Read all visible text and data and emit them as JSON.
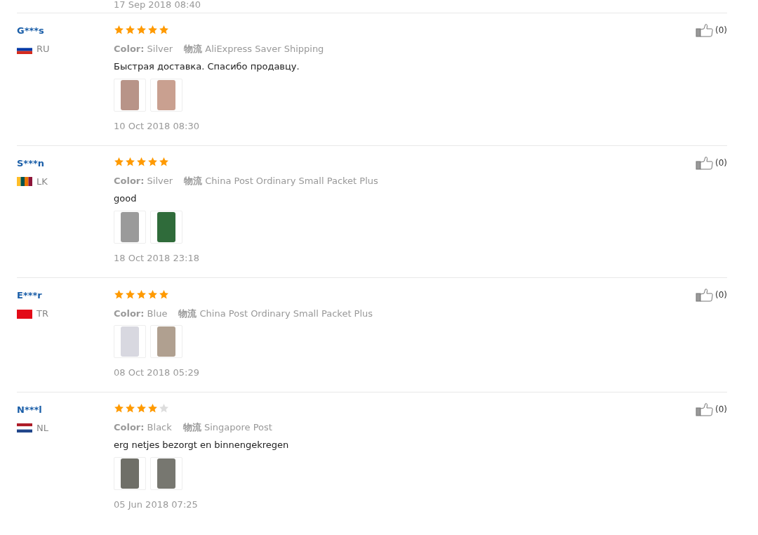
{
  "previous_review": {
    "date": "17 Sep 2018 08:40"
  },
  "reviews": [
    {
      "user": "G***s",
      "country": "RU",
      "flag": {
        "kind": "russia"
      },
      "stars": 5,
      "color_label": "Color:",
      "color_value": "Silver",
      "shipping_label": "物流",
      "shipping_value": "AliExpress Saver Shipping",
      "comment": "Быстрая доставка. Спасибо продавцу.",
      "date": "10 Oct 2018 08:30",
      "helpful": "(0)"
    },
    {
      "user": "S***n",
      "country": "LK",
      "flag": {
        "kind": "sri-lanka"
      },
      "stars": 5,
      "color_label": "Color:",
      "color_value": "Silver",
      "shipping_label": "物流",
      "shipping_value": "China Post Ordinary Small Packet Plus",
      "comment": "good",
      "date": "18 Oct 2018 23:18",
      "helpful": "(0)"
    },
    {
      "user": "E***r",
      "country": "TR",
      "flag": {
        "kind": "turkey"
      },
      "stars": 5,
      "color_label": "Color:",
      "color_value": "Blue",
      "shipping_label": "物流",
      "shipping_value": "China Post Ordinary Small Packet Plus",
      "date": "08 Oct 2018 05:29",
      "helpful": "(0)"
    },
    {
      "user": "N***l",
      "country": "NL",
      "flag": {
        "kind": "netherlands"
      },
      "stars": 4,
      "color_label": "Color:",
      "color_value": "Black",
      "shipping_label": "物流",
      "shipping_value": "Singapore Post",
      "comment": "erg netjes bezorgt en binnengekregen",
      "date": "05 Jun 2018 07:25",
      "helpful": "(0)"
    }
  ]
}
